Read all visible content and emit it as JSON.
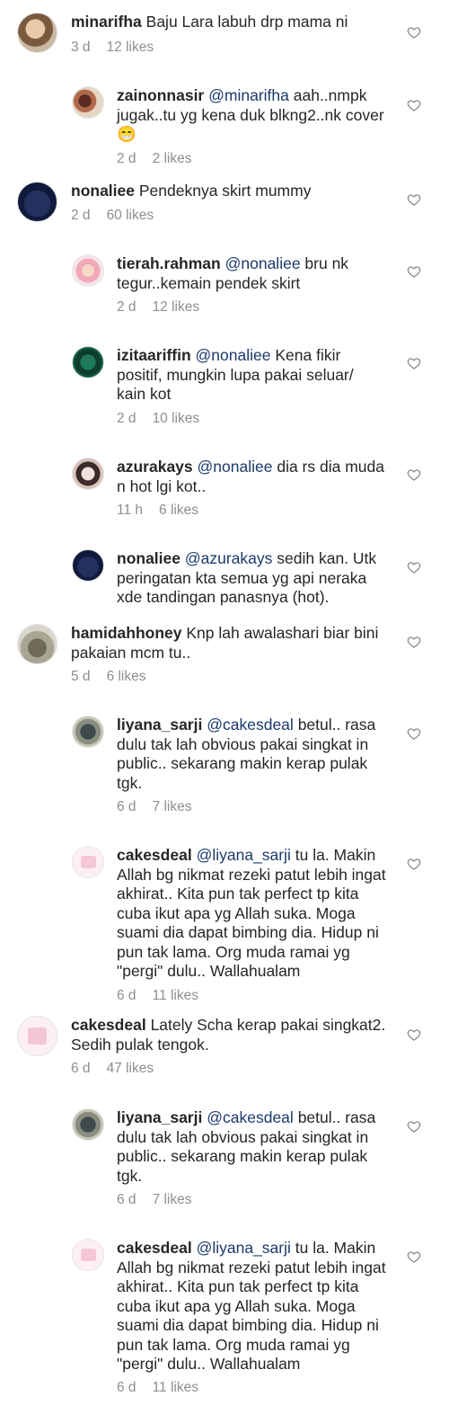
{
  "comments": [
    {
      "kind": "top",
      "avatar": "avatar-photo",
      "username": "minarifha",
      "mention": "",
      "text": "Baju Lara labuh drp mama ni",
      "time": "3 d",
      "likes": "12 likes"
    },
    {
      "kind": "reply",
      "avatar": "avatar-photo",
      "username": "zainonnasir",
      "mention": "@minarifha",
      "text": "aah..nmpk jugak..tu yg kena duk blkng2..nk cover😁",
      "time": "2 d",
      "likes": "2 likes"
    },
    {
      "kind": "top",
      "avatar": "avatar-group-photo",
      "username": "nonaliee",
      "mention": "",
      "text": "Pendeknya skirt mummy",
      "time": "2 d",
      "likes": "60 likes"
    },
    {
      "kind": "reply",
      "avatar": "avatar-photo",
      "username": "tierah.rahman",
      "mention": "@nonaliee",
      "text": "bru nk tegur..kemain pendek skirt",
      "time": "2 d",
      "likes": "12 likes"
    },
    {
      "kind": "reply",
      "avatar": "avatar-photo",
      "username": "izitaariffin",
      "mention": "@nonaliee",
      "text": "Kena fikir positif, mungkin lupa pakai seluar/ kain kot",
      "time": "2 d",
      "likes": "10 likes"
    },
    {
      "kind": "reply",
      "avatar": "avatar-photo",
      "username": "azurakays",
      "mention": "@nonaliee",
      "text": "dia rs dia muda n hot lgi kot..",
      "time": "11 h",
      "likes": "6 likes"
    },
    {
      "kind": "reply",
      "avatar": "avatar-group-photo",
      "username": "nonaliee",
      "mention": "@azurakays",
      "text": "sedih kan. Utk peringatan kta semua yg api neraka xde tandingan panasnya (hot).",
      "time": "",
      "likes": ""
    },
    {
      "kind": "top",
      "avatar": "avatar-photo",
      "username": "hamidahhoney",
      "mention": "",
      "text": "Knp lah awalashari biar bini pakaian mcm tu..",
      "time": "5 d",
      "likes": "6 likes"
    },
    {
      "kind": "reply",
      "avatar": "avatar-photo",
      "username": "liyana_sarji",
      "mention": "@cakesdeal",
      "text": "betul.. rasa dulu tak lah obvious pakai singkat in public.. sekarang makin kerap pulak tgk.",
      "time": "6 d",
      "likes": "7 likes"
    },
    {
      "kind": "reply",
      "avatar": "avatar-logo",
      "username": "cakesdeal",
      "mention": "@liyana_sarji",
      "text": "tu la. Makin Allah bg nikmat rezeki patut lebih ingat akhirat.. Kita pun tak perfect tp kita cuba ikut apa yg Allah suka. Moga suami dia dapat bimbing dia. Hidup ni pun tak lama. Org muda ramai yg \"pergi\" dulu.. Wallahualam",
      "time": "6 d",
      "likes": "11 likes"
    },
    {
      "kind": "top",
      "avatar": "avatar-logo",
      "username": "cakesdeal",
      "mention": "",
      "text": "Lately Scha kerap pakai singkat2.  Sedih pulak tengok.",
      "time": "6 d",
      "likes": "47 likes"
    },
    {
      "kind": "reply",
      "avatar": "avatar-photo",
      "username": "liyana_sarji",
      "mention": "@cakesdeal",
      "text": "betul.. rasa dulu tak lah obvious pakai singkat in public.. sekarang makin kerap pulak tgk.",
      "time": "6 d",
      "likes": "7 likes"
    },
    {
      "kind": "reply",
      "avatar": "avatar-logo",
      "username": "cakesdeal",
      "mention": "@liyana_sarji",
      "text": "tu la. Makin Allah bg nikmat rezeki patut lebih ingat akhirat.. Kita pun tak perfect tp kita cuba ikut apa yg Allah suka. Moga suami dia dapat bimbing dia. Hidup ni pun tak lama. Org muda ramai yg \"pergi\" dulu.. Wallahualam",
      "time": "6 d",
      "likes": "11 likes"
    }
  ],
  "colors": {
    "text": "#262626",
    "mention": "#1b3a6b",
    "meta": "#8e8e8e",
    "heart_outline": "#8e8e8e"
  },
  "icons": {
    "like": "heart-outline-icon"
  }
}
